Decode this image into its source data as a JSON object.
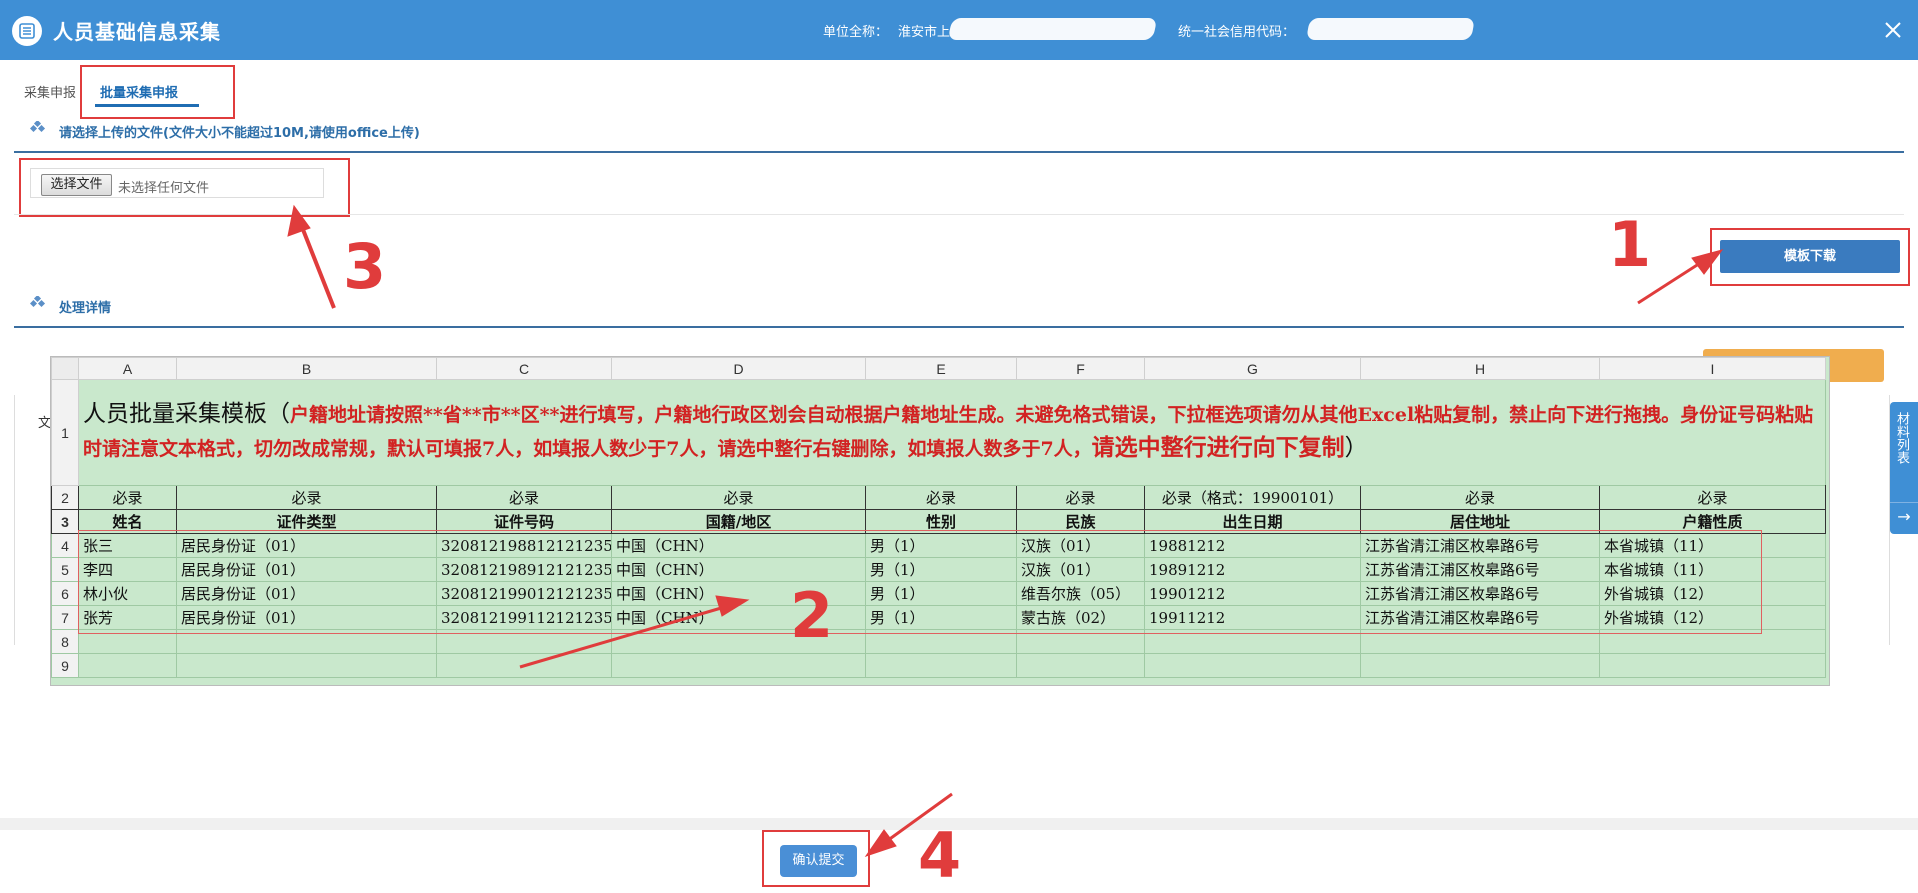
{
  "header": {
    "title": "人员基础信息采集",
    "unit_label": "单位全称：",
    "unit_value": "淮安市上",
    "credit_label": "统一社会信用代码："
  },
  "tabs": [
    {
      "label": "采集申报"
    },
    {
      "label": "批量采集申报"
    }
  ],
  "upload_section": {
    "title": "请选择上传的文件(文件大小不能超过10M,请使用office上传)",
    "choose_button": "选择文件",
    "no_file_text": "未选择任何文件"
  },
  "template_button": "模板下载",
  "details_section": {
    "title": "处理详情"
  },
  "left_fragment": "文",
  "side_tab": {
    "label": "材料列表",
    "arrow": "→"
  },
  "excel": {
    "col_headers": [
      "A",
      "B",
      "C",
      "D",
      "E",
      "F",
      "G",
      "H",
      "I"
    ],
    "row_numbers": [
      "1",
      "2",
      "3",
      "4",
      "5",
      "6",
      "7",
      "8",
      "9"
    ],
    "title_black": "人员批量采集模板（",
    "title_red": "户籍地址请按照**省**市**区**进行填写，户籍地行政区划会自动根据户籍地址生成。未避免格式错误，下拉框选项请勿从其他Excel粘贴复制，禁止向下进行拖拽。身份证号码粘贴时请注意文本格式，切勿改成常规，默认可填报7人，如填报人数少于7人，请选中整行右键删除，如填报人数多于7人，",
    "title_red_big": "请选中整行进行向下复制",
    "title_close": "）",
    "required_row": [
      "必录",
      "必录",
      "必录",
      "必录",
      "必录",
      "必录",
      "必录（格式：19900101）",
      "必录",
      "必录"
    ],
    "field_row": [
      "姓名",
      "证件类型",
      "证件号码",
      "国籍/地区",
      "性别",
      "民族",
      "出生日期",
      "居住地址",
      "户籍性质"
    ],
    "data_rows": [
      [
        "张三",
        "居民身份证（01）",
        "320812198812121235",
        "中国（CHN）",
        "男（1）",
        "汉族（01）",
        "19881212",
        "江苏省清江浦区枚皋路6号",
        "本省城镇（11）"
      ],
      [
        "李四",
        "居民身份证（01）",
        "320812198912121235",
        "中国（CHN）",
        "男（1）",
        "汉族（01）",
        "19891212",
        "江苏省清江浦区枚皋路6号",
        "本省城镇（11）"
      ],
      [
        "林小伙",
        "居民身份证（01）",
        "320812199012121235",
        "中国（CHN）",
        "男（1）",
        "维吾尔族（05）",
        "19901212",
        "江苏省清江浦区枚皋路6号",
        "外省城镇（12）"
      ],
      [
        "张芳",
        "居民身份证（01）",
        "320812199112121235",
        "中国（CHN）",
        "男（1）",
        "蒙古族（02）",
        "19911212",
        "江苏省清江浦区枚皋路6号",
        "外省城镇（12）"
      ]
    ]
  },
  "annotations": [
    "1",
    "2",
    "3",
    "4"
  ],
  "submit_button": "确认提交",
  "colors": {
    "header": "#3f8fd5",
    "annotation": "#e03c3c",
    "primary_button": "#3a7bbf",
    "sheet_fill": "#c9e8cc"
  }
}
